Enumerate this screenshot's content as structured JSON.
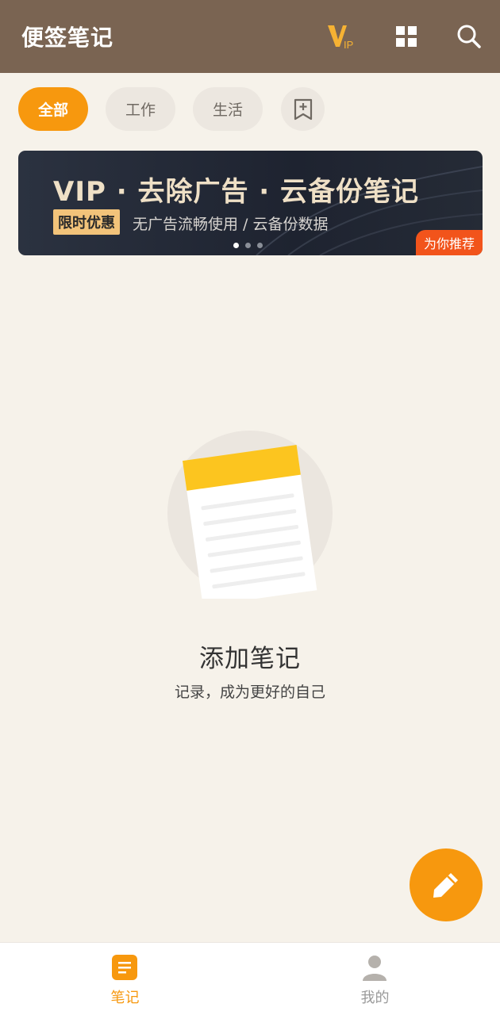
{
  "header": {
    "title": "便签笔记",
    "icons": [
      "vip-icon",
      "grid-icon",
      "search-icon"
    ]
  },
  "filters": {
    "items": [
      {
        "label": "全部",
        "active": true
      },
      {
        "label": "工作",
        "active": false
      },
      {
        "label": "生活",
        "active": false
      }
    ],
    "add_icon": "add-tag-icon"
  },
  "banner": {
    "title": "VIP · 去除广告 · 云备份笔记",
    "badge": "限时优惠",
    "subtitle": "无广告流畅使用 / 云备份数据",
    "tag": "为你推荐",
    "dots": 3,
    "active_dot": 0
  },
  "empty_state": {
    "title": "添加笔记",
    "subtitle": "记录，成为更好的自己"
  },
  "fab": {
    "icon": "pencil-icon"
  },
  "bottom_nav": {
    "items": [
      {
        "label": "笔记",
        "icon": "notes-icon",
        "active": true
      },
      {
        "label": "我的",
        "icon": "user-icon",
        "active": false
      }
    ]
  },
  "colors": {
    "header_bg": "#7a6452",
    "accent": "#f7980e",
    "page_bg": "#f6f2ea"
  }
}
